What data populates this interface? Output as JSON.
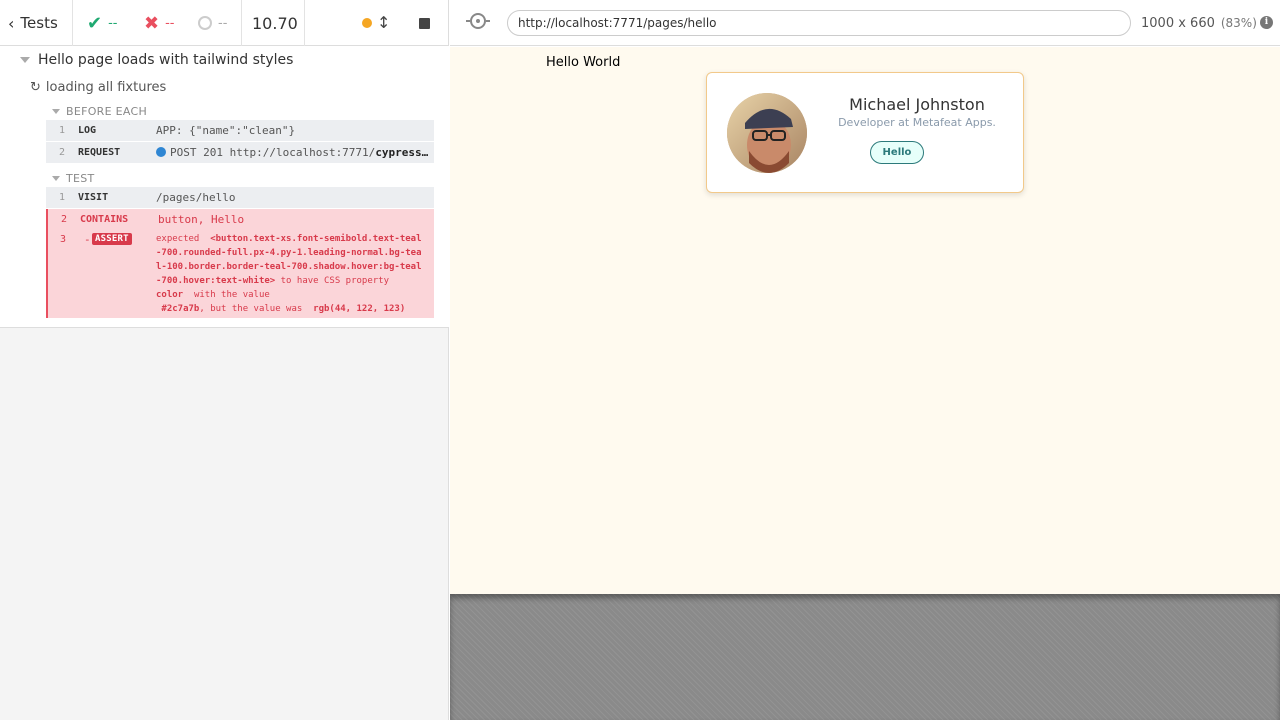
{
  "reporter": {
    "back_label": "Tests",
    "passed": "--",
    "failed": "--",
    "pending": "--",
    "duration": "10.70",
    "suite_title": "Hello page loads with tailwind styles",
    "test_title": "loading all fixtures",
    "before_each": {
      "title": "BEFORE EACH",
      "commands": [
        {
          "num": "1",
          "name": "LOG",
          "msg": "APP: {\"name\":\"clean\"}"
        },
        {
          "num": "2",
          "name": "REQUEST",
          "msg_prefix": "POST 201 http://localhost:7771/",
          "msg_strong": "cypress…"
        }
      ]
    },
    "test": {
      "title": "TEST",
      "commands": [
        {
          "num": "1",
          "name": "VISIT",
          "msg": "/pages/hello"
        },
        {
          "num": "2",
          "name": "CONTAINS",
          "msg": "button, Hello"
        }
      ],
      "assert": {
        "num": "3",
        "dash": "-",
        "badge": "ASSERT",
        "expected_word": "expected",
        "selector": "<button.text-xs.font-semibold.text-teal-700.rounded-full.px-4.py-1.leading-normal.bg-teal-100.border.border-teal-700.shadow.hover:bg-teal-700.hover:text-white>",
        "to_have": "to have CSS property",
        "property": "color",
        "with_value": "with the value",
        "expected_value": "#2c7a7b",
        "but_was": ", but the value was",
        "actual_value": "rgb(44, 122, 123)"
      }
    }
  },
  "aut": {
    "url": "http://localhost:7771/pages/hello",
    "viewport": "1000 x 660",
    "scale": "(83%)",
    "info": "i",
    "page": {
      "heading": "Hello World",
      "card": {
        "name": "Michael Johnston",
        "role": "Developer at Metafeat Apps.",
        "button": "Hello"
      }
    }
  },
  "colors": {
    "pass": "#1fa971",
    "fail": "#e94f5f",
    "teal": "#2c7a7b",
    "app_bg": "#fffaef"
  },
  "icons": [
    "chevron-left-icon",
    "check-icon",
    "x-icon",
    "pending-ring-icon",
    "running-dot-icon",
    "resize-icon",
    "stop-icon",
    "spinner-icon",
    "selector-playground-icon",
    "info-icon"
  ]
}
